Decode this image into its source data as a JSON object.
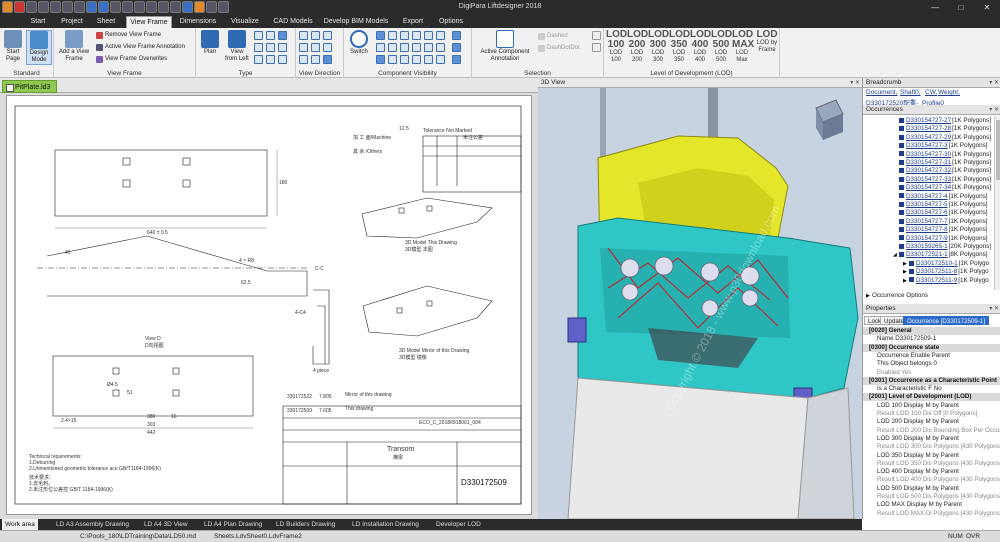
{
  "app": {
    "title": "DigiPara Liftdesigner 2018"
  },
  "window_controls": {
    "min": "—",
    "max": "□",
    "close": "✕"
  },
  "menu": [
    "Start",
    "Project",
    "Sheet",
    "View Frame",
    "Dimensions",
    "Visualize",
    "CAD Models",
    "Develop BIM Models",
    "Export",
    "Options"
  ],
  "menu_active": "View Frame",
  "ribbon": {
    "standard": {
      "label": "Standard",
      "start_page": "Start\nPage",
      "design_mode": "Design\nMode"
    },
    "view_frame": {
      "label": "View Frame",
      "add": "Add a View\nFrame",
      "remove": "Remove View Frame",
      "annotation": "Active View Frame Annotation",
      "overwrites": "View Frame Overwrites"
    },
    "type": {
      "label": "Type",
      "plan": "Plan",
      "view_from_left": "View\nfrom Left"
    },
    "view_direction": {
      "label": "View Direction"
    },
    "component_visibility": {
      "label": "Component Visibility",
      "switch": "Switch"
    },
    "selection": {
      "label": "Selection",
      "active_component": "Active Component\nAnnotation",
      "dashed": "Dashed",
      "dashdotdot": "DashDotDot"
    },
    "lod": {
      "label": "Level of Development (LOD)",
      "buttons": [
        {
          "big": "LOD\n100",
          "small": "LOD\n100"
        },
        {
          "big": "LOD\n200",
          "small": "LOD\n200"
        },
        {
          "big": "LOD\n300",
          "small": "LOD\n300"
        },
        {
          "big": "LOD\n350",
          "small": "LOD\n350"
        },
        {
          "big": "LOD\n400",
          "small": "LOD\n400"
        },
        {
          "big": "LOD\n500",
          "small": "LOD\n500"
        },
        {
          "big": "LOD\nMAX",
          "small": "LOD\nMax"
        },
        {
          "big": "LOD",
          "small": "LOD by\nFrame"
        }
      ]
    }
  },
  "document": {
    "tab": "PitPlate.ld3"
  },
  "drawing": {
    "title_block": {
      "name": "Transom",
      "sub": "横梁",
      "part_no": "D330172509",
      "code": "ECO_C_20180918001_004"
    },
    "tolerance_hdr": "Tolerance Not Marked",
    "tolerance_hdr_cn": "未注公差",
    "machine": "加 工 面/Machine",
    "others": "其 余 /Others",
    "ra": "12.5",
    "dim_length": "640 ± 0.5",
    "dim_height": "180",
    "section_label": "C-C",
    "view_d": "View D",
    "view_d_cn": "D向视图",
    "model_this": "3D Model This Drawing",
    "model_this_cn": "3D模型 本图",
    "model_mirror": "3D Model Mirror of this Drawing",
    "model_mirror_cn": "3D模型 镜像",
    "mirror_this": "Mirror of this drawing",
    "this_drawing": "This drawing",
    "piece_no": "4 piece",
    "tech": [
      "Technical requirements:",
      "1.Deburring",
      "2.Unmentioned geometric tolerance ace.GB/T1184-1996(K)",
      "技术要求：",
      "1.去毛刺。",
      "2.未注形位公差控 GB/T 1184-1996(K)"
    ],
    "nums": [
      "330172522",
      "7.805",
      "330172509",
      "7.605",
      "442",
      "303",
      "380",
      "2.4×15",
      "4 × R8",
      "62.5",
      "45",
      "4-C4",
      "51",
      "Ø4.5",
      "16"
    ]
  },
  "view3d": {
    "title": "3D View",
    "watermark": "Copyright © 2018 - www.p30download.com"
  },
  "breadcrumb": {
    "title": "Breadcrumb",
    "items": [
      "Document,",
      "Shaft0,",
      "CW,",
      "Weight,"
    ],
    "line2": "D330172520配重-_Profile0"
  },
  "occurrences": {
    "title": "Occurrences",
    "items": [
      {
        "id": "D330154727-27",
        "info": "[1K Polygons]"
      },
      {
        "id": "D330154727-28",
        "info": "[1K Polygons]"
      },
      {
        "id": "D330154727-29",
        "info": "[1K Polygons]"
      },
      {
        "id": "D330154727-3",
        "info": "[1K Polygons]"
      },
      {
        "id": "D330154727-30",
        "info": "[1K Polygons]"
      },
      {
        "id": "D330154727-31",
        "info": "[1K Polygons]"
      },
      {
        "id": "D330154727-32",
        "info": "[1K Polygons]"
      },
      {
        "id": "D330154727-33",
        "info": "[1K Polygons]"
      },
      {
        "id": "D330154727-34",
        "info": "[1K Polygons]"
      },
      {
        "id": "D330154727-4",
        "info": "[1K Polygons]"
      },
      {
        "id": "D330154727-5",
        "info": "[1K Polygons]"
      },
      {
        "id": "D330154727-6",
        "info": "[1K Polygons]"
      },
      {
        "id": "D330154727-7",
        "info": "[1K Polygons]"
      },
      {
        "id": "D330154727-8",
        "info": "[1K Polygons]"
      },
      {
        "id": "D330154727-9",
        "info": "[1K Polygons]"
      },
      {
        "id": "D330159265-1",
        "info": "[20K Polygons]"
      },
      {
        "id": "D330172521-1",
        "info": "[8K Polygons]"
      },
      {
        "id": "D330172510-1",
        "info": "[1K Polygo"
      },
      {
        "id": "D330172511-8",
        "info": "[1K Polygo"
      },
      {
        "id": "D330172511-9",
        "info": "[1K Polygo"
      }
    ],
    "options": "Occurrence Options"
  },
  "properties": {
    "title": "Properties",
    "buttons": [
      "Lock",
      "Update",
      "Occurrence [D330172509-1]"
    ],
    "rows": [
      {
        "t": "sec",
        "text": "[0020] General"
      },
      {
        "t": "row",
        "text": "Name                D330172509-1"
      },
      {
        "t": "sec",
        "text": "[0300] Occurrence state"
      },
      {
        "t": "row",
        "text": "Occurrence Enable  Parent"
      },
      {
        "t": "row",
        "text": "This Object belongs 0"
      },
      {
        "t": "dim",
        "text": "Enabled              Yes"
      },
      {
        "t": "sec",
        "text": "[0301] Occurrence as a Characteristic Point"
      },
      {
        "t": "row",
        "text": "Is a Characteristic F No"
      },
      {
        "t": "sec",
        "text": "[2001] Level of Development (LOD)"
      },
      {
        "t": "row",
        "text": "LOD 100 Display M by Parent"
      },
      {
        "t": "dim",
        "text": "Result LOD 100 Dis Off [0 Polygons]"
      },
      {
        "t": "row",
        "text": "LOD 200 Display M by Parent"
      },
      {
        "t": "dim",
        "text": "Result LOD 200 Dis Bounding Box Per Occurrence"
      },
      {
        "t": "row",
        "text": "LOD 300 Display M by Parent"
      },
      {
        "t": "dim",
        "text": "Result LOD 300 Dis Polygons [430 Polygons]"
      },
      {
        "t": "row",
        "text": "LOD 350 Display M by Parent"
      },
      {
        "t": "dim",
        "text": "Result LOD 350 Dis Polygons [430 Polygons]"
      },
      {
        "t": "row",
        "text": "LOD 400 Display M by Parent"
      },
      {
        "t": "dim",
        "text": "Result LOD 400 Dis Polygons [430 Polygons]"
      },
      {
        "t": "row",
        "text": "LOD 500 Display M by Parent"
      },
      {
        "t": "dim",
        "text": "Result LOD 500 Dis Polygons [430 Polygons]"
      },
      {
        "t": "row",
        "text": "LOD MAX Display M by Parent"
      },
      {
        "t": "dim",
        "text": "Result LOD MAX Di Polygons [430 Polygons]"
      }
    ]
  },
  "bottom_tabs": [
    "Work area",
    "LD A3 Assembly Drawing",
    "LD A4 3D View",
    "LD A4 Plan Drawing",
    "LD Builders Drawing",
    "LD Installation Drawing",
    "Developer LOD"
  ],
  "status": {
    "path": "C:\\Pools_180\\LDTraining\\Data\\LD50.md",
    "sheet": "Sheets.LdvSheet0.LdvFrame2",
    "num": "NUM",
    "ovr": "OVR"
  }
}
